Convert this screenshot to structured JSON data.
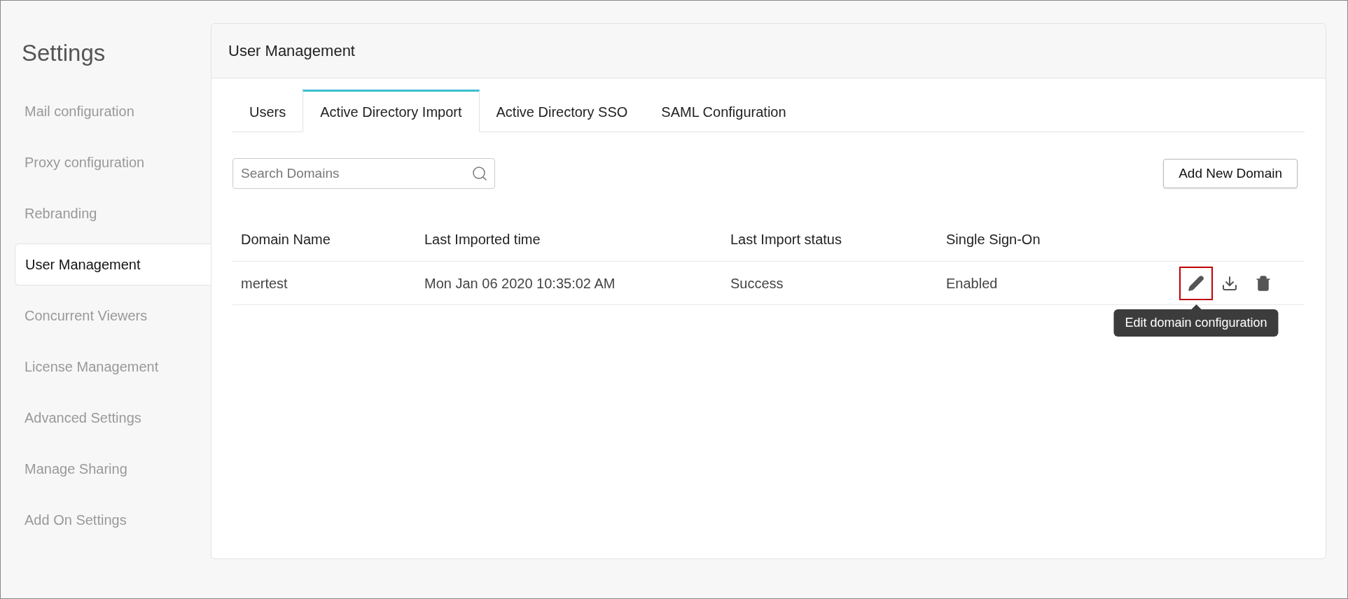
{
  "sidebar": {
    "title": "Settings",
    "items": [
      {
        "label": "Mail configuration",
        "selected": false
      },
      {
        "label": "Proxy configuration",
        "selected": false
      },
      {
        "label": "Rebranding",
        "selected": false
      },
      {
        "label": "User Management",
        "selected": true
      },
      {
        "label": "Concurrent Viewers",
        "selected": false
      },
      {
        "label": "License Management",
        "selected": false
      },
      {
        "label": "Advanced Settings",
        "selected": false
      },
      {
        "label": "Manage Sharing",
        "selected": false
      },
      {
        "label": "Add On Settings",
        "selected": false
      }
    ]
  },
  "panel": {
    "title": "User Management",
    "tabs": [
      {
        "label": "Users",
        "selected": false
      },
      {
        "label": "Active Directory Import",
        "selected": true
      },
      {
        "label": "Active Directory SSO",
        "selected": false
      },
      {
        "label": "SAML Configuration",
        "selected": false
      }
    ],
    "search": {
      "placeholder": "Search Domains"
    },
    "add_button": "Add New Domain",
    "table": {
      "columns": [
        "Domain Name",
        "Last Imported time",
        "Last Import status",
        "Single Sign-On"
      ],
      "rows": [
        {
          "cells": [
            "mertest",
            "Mon Jan 06 2020 10:35:02 AM",
            "Success",
            "Enabled"
          ],
          "actions": [
            {
              "kind": "edit",
              "highlighted": true,
              "tooltip": "Edit domain configuration"
            },
            {
              "kind": "download",
              "highlighted": false
            },
            {
              "kind": "delete",
              "highlighted": false
            }
          ]
        }
      ]
    }
  }
}
